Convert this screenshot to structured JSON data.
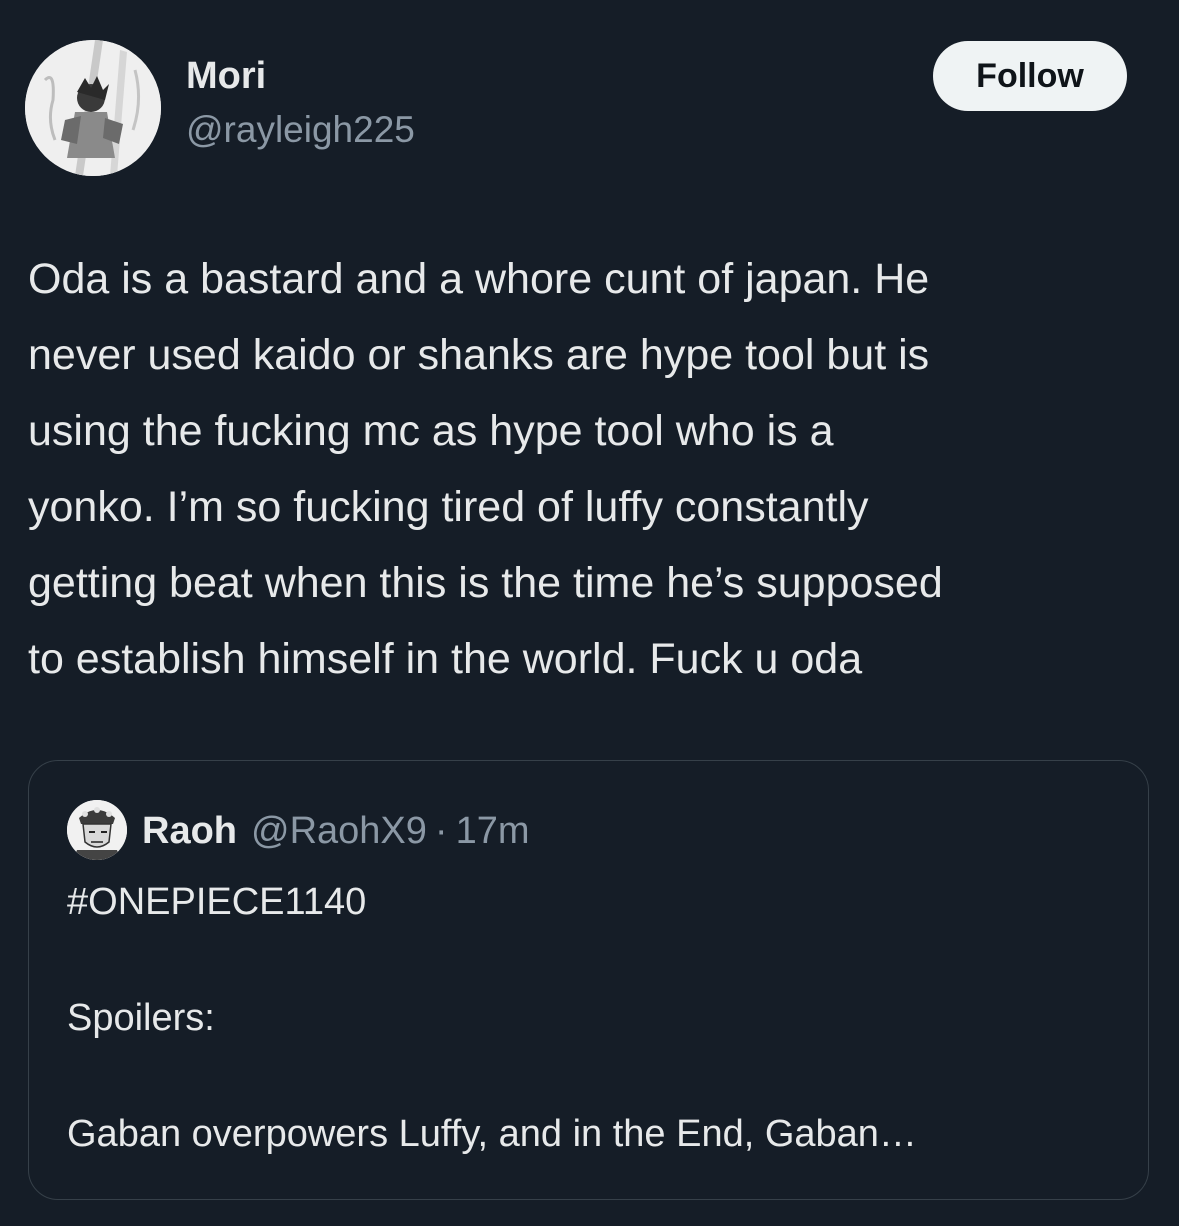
{
  "author": {
    "display_name": "Mori",
    "handle": "@rayleigh225",
    "avatar_icon": "manga-character-avatar"
  },
  "follow_button": {
    "label": "Follow"
  },
  "post": {
    "lines": [
      "Oda is a bastard and a whore cunt of japan. He",
      "never used kaido or shanks are hype tool but is",
      "using the fucking mc as hype tool who is a",
      "yonko. I’m so fucking tired of luffy constantly",
      "getting beat when this is the time he’s supposed",
      "to establish himself in the world. Fuck u oda"
    ]
  },
  "quote": {
    "display_name": "Raoh",
    "handle": "@RaohX9",
    "separator": "·",
    "time": "17m",
    "avatar_icon": "manga-character-avatar",
    "lines": [
      "#ONEPIECE1140",
      "",
      "Spoilers:",
      "",
      "Gaban overpowers Luffy, and in the End, Gaban…"
    ]
  },
  "colors": {
    "background": "#151d27",
    "primary_text": "#e7e9ea",
    "secondary_text": "#8b98a5",
    "follow_button_bg": "#eff3f4",
    "quote_border": "#364049"
  }
}
